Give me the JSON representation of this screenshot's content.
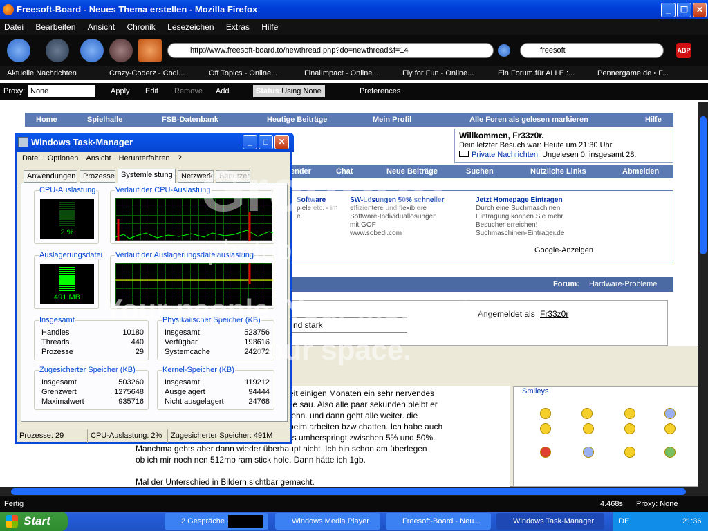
{
  "firefox": {
    "title": "Freesoft-Board - Neues Thema erstellen - Mozilla Firefox",
    "menu": [
      "Datei",
      "Bearbeiten",
      "Ansicht",
      "Chronik",
      "Lesezeichen",
      "Extras",
      "Hilfe"
    ],
    "url": "http://www.freesoft-board.to/newthread.php?do=newthread&f=14",
    "search": "freesoft",
    "bookmarks": [
      "Aktuelle Nachrichten",
      "Crazy-Coderz - Codi...",
      "Off Topics - Online...",
      "FinalImpact - Online...",
      "Fly for Fun - Online...",
      "Ein Forum für ALLE :...",
      "Pennergame.de • F..."
    ],
    "proxy": {
      "label": "Proxy:",
      "value": "None",
      "apply": "Apply",
      "edit": "Edit",
      "remove": "Remove",
      "add": "Add",
      "status_label": "Status:",
      "status": "Using None",
      "prefs": "Preferences"
    },
    "statusbar": {
      "left": "Fertig",
      "time": "4.468s",
      "proxy": "Proxy: None"
    }
  },
  "forum": {
    "nav": [
      "Home",
      "Spielhalle",
      "FSB-Datenbank",
      "Heutige Beiträge",
      "Mein Profil",
      "Alle Foren als gelesen markieren",
      "Hilfe"
    ],
    "welcome": {
      "title": "Willkommen, Fr33z0r.",
      "last_visit": "Dein letzter Besuch war: Heute um 21:30 Uhr",
      "pm_link": "Private Nachrichten",
      "pm_text": ": Ungelesen 0, insgesamt 28."
    },
    "nav2": [
      "ender",
      "Chat",
      "Neue Beiträge",
      "Suchen",
      "Nützliche Links",
      "Abmelden"
    ],
    "ads": [
      {
        "title": "Software",
        "l1": "",
        "l2": "piele etc. - im",
        "l3": "e"
      },
      {
        "title": "SW-Lösungen 50% schneller",
        "l1": "effizientere und flexiblere",
        "l2": "Software-Individuallösungen",
        "l3": "mit GOF",
        "l4": "www.sobedi.com"
      },
      {
        "title": "Jetzt Homepage Eintragen",
        "l1": "Durch eine Suchmaschinen",
        "l2": "Eintragung können Sie mehr",
        "l3": "Besucher erreichen!",
        "l4": "Suchmaschinen-Eintrager.de"
      }
    ],
    "google": "Google-Anzeigen",
    "forum_label": "Forum:",
    "forum_name": "Hardware-Probleme",
    "logged_in": "Angemeldet als",
    "logged_user": "Fr33z0r",
    "subject_tail": "nd stark",
    "post_lines": [
      "seit einigen Monaten ein sehr nervendes",
      "wie sau. Also alle paar sekunden bleibt er",
      "stehn. und dann geht alle weiter. die",
      "l beim arbeiten bzw chatten. Ich habe auch",
      "ers umherspringt zwischen 5% und 50%.",
      "Manchma gehts aber dann wieder überhaupt nicht. Ich bin schon am überlegen",
      "ob ich mir noch nen 512mb ram stick hole. Dann hätte ich 1gb.",
      "",
      "Mal der Unterschied in Bildern sichtbar gemacht."
    ],
    "smileys_label": "Smileys"
  },
  "taskmanager": {
    "title": "Windows Task-Manager",
    "menu": [
      "Datei",
      "Optionen",
      "Ansicht",
      "Herunterfahren",
      "?"
    ],
    "tabs": [
      "Anwendungen",
      "Prozesse",
      "Systemleistung",
      "Netzwerk",
      "Benutzer"
    ],
    "cpu_label": "CPU-Auslastung",
    "cpu_value": "2 %",
    "cpu_percent": 2,
    "cpu_history_label": "Verlauf der CPU-Auslastung",
    "page_label": "Auslagerungsdatei",
    "page_value": "491 MB",
    "page_history_label": "Verlauf der Auslagerungsdateiauslastung",
    "totals": {
      "label": "Insgesamt",
      "rows": [
        [
          "Handles",
          "10180"
        ],
        [
          "Threads",
          "440"
        ],
        [
          "Prozesse",
          "29"
        ]
      ]
    },
    "physical": {
      "label": "Physikalischer Speicher (KB)",
      "rows": [
        [
          "Insgesamt",
          "523756"
        ],
        [
          "Verfügbar",
          "198616"
        ],
        [
          "Systemcache",
          "242072"
        ]
      ]
    },
    "commit": {
      "label": "Zugesicherter Speicher (KB)",
      "rows": [
        [
          "Insgesamt",
          "503260"
        ],
        [
          "Grenzwert",
          "1275648"
        ],
        [
          "Maximalwert",
          "935716"
        ]
      ]
    },
    "kernel": {
      "label": "Kernel-Speicher (KB)",
      "rows": [
        [
          "Insgesamt",
          "119212"
        ],
        [
          "Ausgelagert",
          "94444"
        ],
        [
          "Nicht ausgelagert",
          "24768"
        ]
      ]
    },
    "status": {
      "procs": "Prozesse: 29",
      "cpu": "CPU-Auslastung: 2%",
      "commit": "Zugesicherter Speicher: 491M"
    }
  },
  "taskbar": {
    "start": "Start",
    "tasks": [
      "2 Gespräche -",
      "Windows Media Player",
      "Freesoft-Board - Neu...",
      "Windows Task-Manager"
    ],
    "lang": "DE",
    "clock": "21:36"
  },
  "watermark": {
    "brand": "Groupon",
    "line1": "photobucket",
    "line2": "Your people. Your moments.",
    "line3": "Your space."
  }
}
